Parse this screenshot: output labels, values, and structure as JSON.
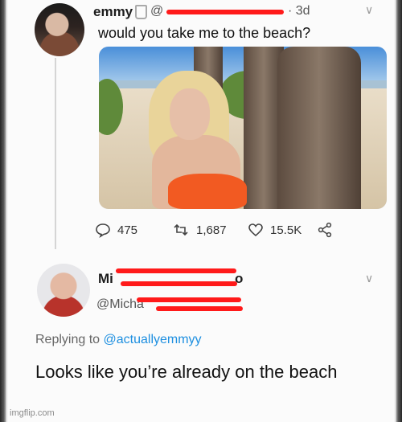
{
  "tweet": {
    "display_name": "emmy",
    "handle_prefix": "@",
    "timestamp": "· 3d",
    "text": "would you take me to the beach?",
    "stats": {
      "replies": "475",
      "retweets": "1,687",
      "likes": "15.5K"
    }
  },
  "reply": {
    "display_name_visible": "Mi",
    "display_name_end": "o",
    "handle_visible": "@Micha",
    "replying_to_prefix": "Replying to",
    "replying_to_handle": "@actuallyemmyy",
    "text": "Looks like you’re already on the beach"
  },
  "watermark": "imgflip.com",
  "colors": {
    "redaction": "#ff1a1a",
    "link": "#1d8fe0",
    "bikini": "#f25a22"
  },
  "icons": {
    "reply": "comment-bubble-icon",
    "retweet": "retweet-icon",
    "like": "heart-icon",
    "share": "share-icon",
    "caret": "chevron-down-icon"
  }
}
